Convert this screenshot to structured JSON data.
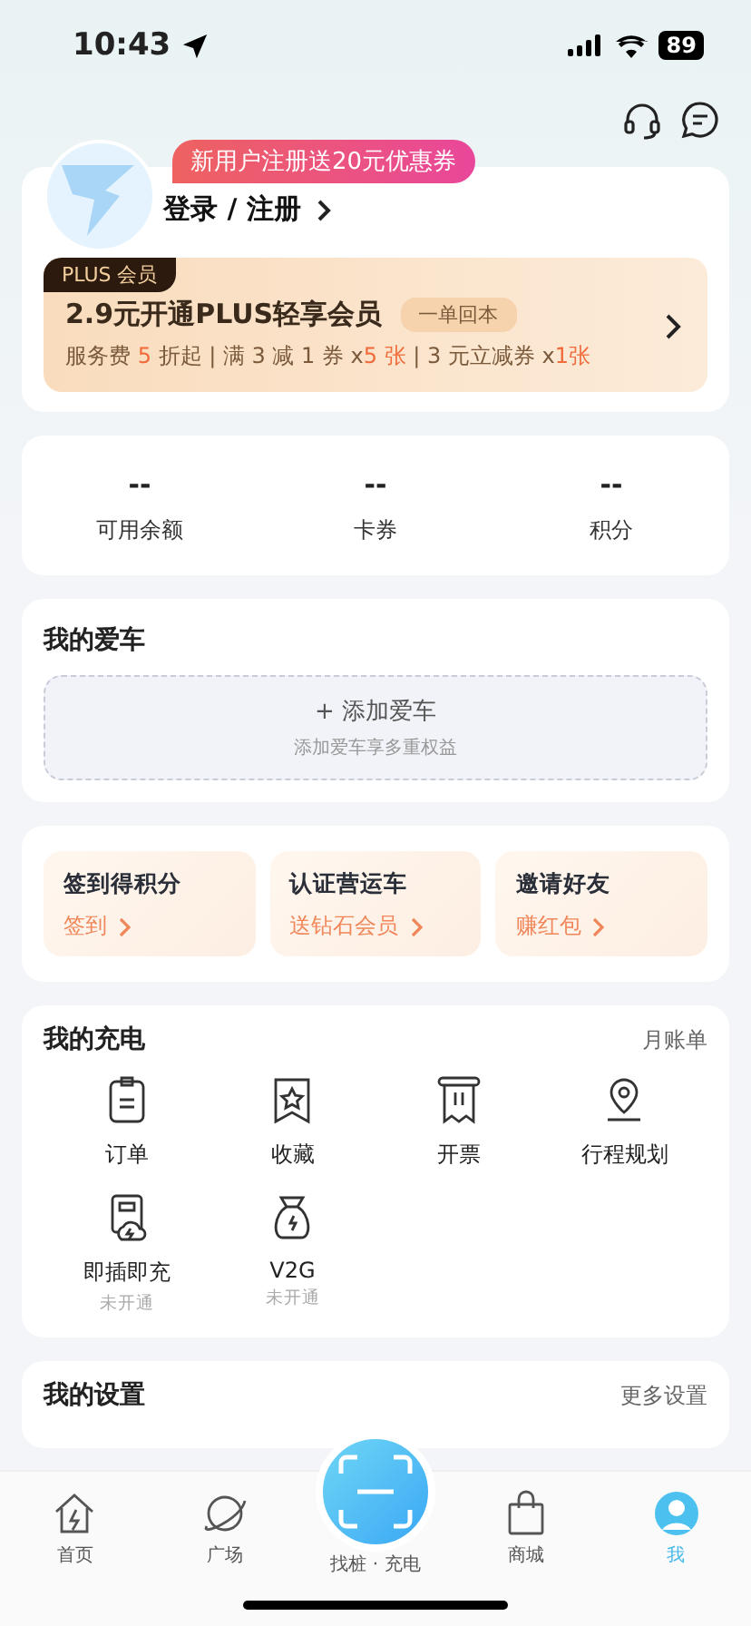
{
  "status_bar": {
    "time": "10:43",
    "battery": "89"
  },
  "profile": {
    "promo_badge": "新用户注册送20元优惠券",
    "login": "登录 / 注册"
  },
  "plus": {
    "tag": "PLUS 会员",
    "title": "2.9元开通PLUS轻享会员",
    "chip": "一单回本",
    "benefits": [
      {
        "text": "服务费 ",
        "highlight": false
      },
      {
        "text": "5",
        "highlight": true
      },
      {
        "text": " 折起 | 满 3 减 1 券 x",
        "highlight": false
      },
      {
        "text": "5 张",
        "highlight": true
      },
      {
        "text": " | 3 元立减券 x",
        "highlight": false
      },
      {
        "text": "1张",
        "highlight": true
      }
    ]
  },
  "stats": [
    {
      "value": "--",
      "label": "可用余额"
    },
    {
      "value": "--",
      "label": "卡券"
    },
    {
      "value": "--",
      "label": "积分"
    }
  ],
  "my_car": {
    "title": "我的爱车",
    "add_button": "+ 添加爱车",
    "hint": "添加爱车享多重权益"
  },
  "promos": [
    {
      "title": "签到得积分",
      "action": "签到"
    },
    {
      "title": "认证营运车",
      "action": "送钻石会员"
    },
    {
      "title": "邀请好友",
      "action": "赚红包"
    }
  ],
  "charging": {
    "title": "我的充电",
    "link": "月账单",
    "items": [
      {
        "kind": "order",
        "label": "订单"
      },
      {
        "kind": "favorite",
        "label": "收藏"
      },
      {
        "kind": "invoice",
        "label": "开票"
      },
      {
        "kind": "route",
        "label": "行程规划"
      },
      {
        "kind": "plug",
        "label": "即插即充",
        "note": "未开通"
      },
      {
        "kind": "v2g",
        "label": "V2G",
        "note": "未开通"
      }
    ]
  },
  "settings": {
    "title": "我的设置",
    "link": "更多设置"
  },
  "tab_bar": [
    {
      "kind": "home",
      "label": "首页",
      "selected": false
    },
    {
      "kind": "planet",
      "label": "广场",
      "selected": false
    },
    {
      "kind": "scan",
      "label": "找桩 · 充电",
      "selected": false
    },
    {
      "kind": "bag",
      "label": "商城",
      "selected": false
    },
    {
      "kind": "user",
      "label": "我",
      "selected": true
    }
  ]
}
